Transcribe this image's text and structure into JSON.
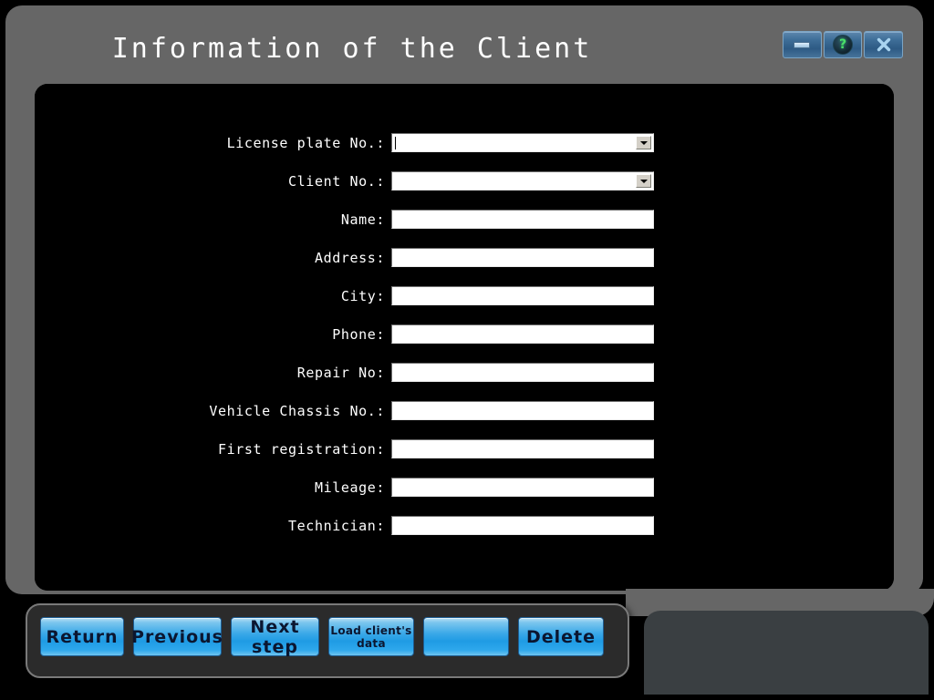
{
  "window": {
    "title": "Information of the Client",
    "controls": [
      {
        "name": "minimize",
        "icon": "minimize-icon",
        "label": ""
      },
      {
        "name": "help",
        "icon": "help-icon",
        "label": "?"
      },
      {
        "name": "close",
        "icon": "close-icon",
        "label": ""
      }
    ]
  },
  "form": {
    "fields": [
      {
        "label": "License plate No.:",
        "type": "combobox",
        "value": "",
        "focused": true
      },
      {
        "label": "Client No.:",
        "type": "combobox",
        "value": ""
      },
      {
        "label": "Name:",
        "type": "text",
        "value": ""
      },
      {
        "label": "Address:",
        "type": "text",
        "value": ""
      },
      {
        "label": "City:",
        "type": "text",
        "value": ""
      },
      {
        "label": "Phone:",
        "type": "text",
        "value": ""
      },
      {
        "label": "Repair No:",
        "type": "text",
        "value": ""
      },
      {
        "label": "Vehicle Chassis No.:",
        "type": "text",
        "value": ""
      },
      {
        "label": "First registration:",
        "type": "text",
        "value": ""
      },
      {
        "label": "Mileage:",
        "type": "text",
        "value": ""
      },
      {
        "label": "Technician:",
        "type": "text",
        "value": ""
      }
    ]
  },
  "toolbar": {
    "buttons": [
      {
        "id": "return",
        "label": "Return"
      },
      {
        "id": "previous",
        "label": "Previous"
      },
      {
        "id": "next",
        "label": "Next step"
      },
      {
        "id": "load",
        "label": "Load client's\ndata"
      },
      {
        "id": "blank",
        "label": ""
      },
      {
        "id": "delete",
        "label": "Delete"
      }
    ]
  },
  "colors": {
    "bezel": "#666666",
    "panel": "#000000",
    "button_blue": "#1f9be4",
    "button_text": "#0b1630",
    "title_text": "#ffffff",
    "help_green": "#49e06a",
    "close_blue": "#8fc6ea",
    "bottom_panel": "#3a3f42"
  }
}
